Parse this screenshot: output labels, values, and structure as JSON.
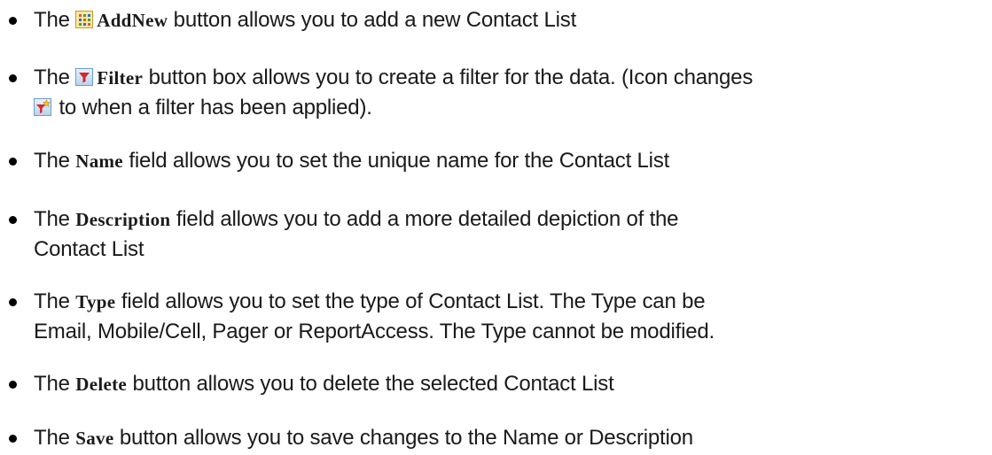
{
  "items": [
    {
      "pre": "The ",
      "keyword": "AddNew",
      "post": " button allows you to add a new Contact List"
    },
    {
      "pre": "The ",
      "keyword": "Filter",
      "post": " button box allows you to create a filter for the data. (Icon changes",
      "post2": " to when a filter has been applied)."
    },
    {
      "pre": "The ",
      "keyword": "Name",
      "post": " field allows you to set the unique name for the Contact List"
    },
    {
      "pre": "The ",
      "keyword": "Description",
      "post": " field allows you to add a more detailed depiction of the",
      "post2": "Contact List"
    },
    {
      "pre": "The ",
      "keyword": "Type",
      "post": " field allows you to set the type of Contact List. The Type can be",
      "post2": "Email, Mobile/Cell, Pager or ReportAccess. The Type cannot be modified."
    },
    {
      "pre": "The ",
      "keyword": "Delete",
      "post": " button allows you to delete the selected Contact List"
    },
    {
      "pre": "The ",
      "keyword": "Save",
      "post": " button allows you to save changes to the Name or Description"
    }
  ],
  "icons": {
    "addnew": "add-new-grid-icon",
    "filter": "funnel-filter-icon",
    "filter_applied": "funnel-filter-applied-icon"
  },
  "colors": {
    "text": "#1a1a1a",
    "bullet": "#000000",
    "addnew_fill": "#fbe7a5",
    "filter_fill": "#b9d3ee",
    "filter_funnel": "#d9262c"
  }
}
